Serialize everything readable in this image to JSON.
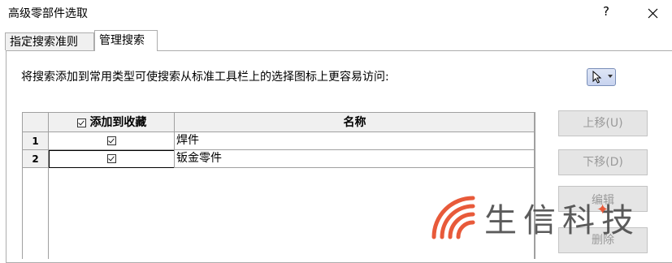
{
  "window": {
    "title": "高级零部件选取",
    "help_label": "?",
    "close_icon": "close-icon"
  },
  "tabs": [
    {
      "label": "指定搜索准则"
    },
    {
      "label": "管理搜索"
    }
  ],
  "instruction": "将搜索添加到常用类型可使搜索从标准工具栏上的选择图标上更容易访问:",
  "pointer_button": {
    "icon": "pointer-arrow-icon"
  },
  "grid": {
    "columns": {
      "favorite": "添加到收藏",
      "name": "名称"
    },
    "rows": [
      {
        "num": "1",
        "favorite": true,
        "name": "焊件"
      },
      {
        "num": "2",
        "favorite": true,
        "name": "钣金零件"
      }
    ]
  },
  "side_buttons": {
    "up": "上移(U)",
    "down": "下移(D)",
    "edit": "编辑",
    "delete": "删除"
  },
  "watermark": {
    "text": "生信科技"
  },
  "colors": {
    "accent": "#e85a3a",
    "disabled_text": "#9a9a9a",
    "tab_bg": "#f0f0f0"
  }
}
